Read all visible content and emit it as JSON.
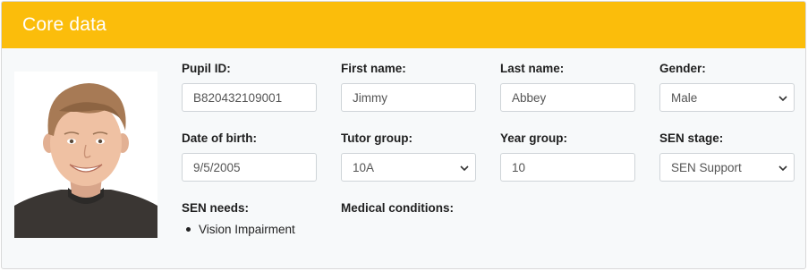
{
  "header": {
    "title": "Core data"
  },
  "photo": {
    "alt": "Pupil photo"
  },
  "fields": {
    "pupil_id": {
      "label": "Pupil ID:",
      "value": "B820432109001"
    },
    "first_name": {
      "label": "First name:",
      "value": "Jimmy"
    },
    "last_name": {
      "label": "Last name:",
      "value": "Abbey"
    },
    "gender": {
      "label": "Gender:",
      "value": "Male"
    },
    "dob": {
      "label": "Date of birth:",
      "value": "9/5/2005"
    },
    "tutor_group": {
      "label": "Tutor group:",
      "value": "10A"
    },
    "year_group": {
      "label": "Year group:",
      "value": "10"
    },
    "sen_stage": {
      "label": "SEN stage:",
      "value": "SEN Support"
    }
  },
  "sen_needs": {
    "label": "SEN needs:",
    "items": [
      "Vision Impairment"
    ]
  },
  "medical": {
    "label": "Medical conditions:"
  },
  "colors": {
    "header": "#fbbd0b",
    "header_text": "#ffffff",
    "body_bg": "#f7f9fa"
  }
}
